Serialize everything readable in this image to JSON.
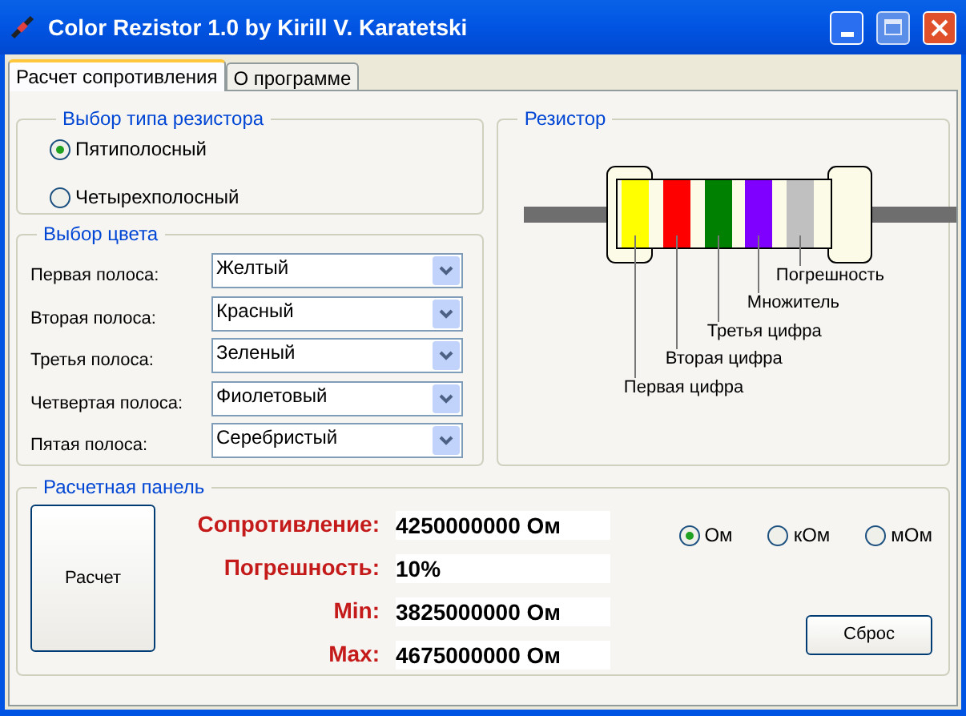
{
  "window": {
    "title": "Color Rezistor 1.0 by Kirill V. Karatetski"
  },
  "tabs": [
    {
      "label": "Расчет сопротивления",
      "selected": true
    },
    {
      "label": "О программе",
      "selected": false
    }
  ],
  "resistor_type": {
    "title": "Выбор типа резистора",
    "options": [
      {
        "label": "Пятиполосный",
        "selected": true
      },
      {
        "label": "Четырехполосный",
        "selected": false
      }
    ]
  },
  "color_choice": {
    "title": "Выбор цвета",
    "bands": [
      {
        "label": "Первая полоса:",
        "value": "Желтый"
      },
      {
        "label": "Вторая полоса:",
        "value": "Красный"
      },
      {
        "label": "Третья полоса:",
        "value": "Зеленый"
      },
      {
        "label": "Четвертая полоса:",
        "value": "Фиолетовый"
      },
      {
        "label": "Пятая полоса:",
        "value": "Серебристый"
      }
    ]
  },
  "resistor": {
    "title": "Резистор",
    "bands": [
      {
        "color": "#ffff00"
      },
      {
        "color": "#ff0000"
      },
      {
        "color": "#008000"
      },
      {
        "color": "#8000ff"
      },
      {
        "color": "#c0c0c0"
      }
    ],
    "captions": [
      "Погрешность",
      "Множитель",
      "Третья цифра",
      "Вторая цифра",
      "Первая цифра"
    ]
  },
  "calc_panel": {
    "title": "Расчетная панель",
    "calculate_button": "Расчет",
    "results": [
      {
        "label": "Сопротивление:",
        "value": "4250000000 Ом"
      },
      {
        "label": "Погрешность:",
        "value": "10%"
      },
      {
        "label": "Min:",
        "value": "3825000000 Ом"
      },
      {
        "label": "Max:",
        "value": "4675000000 Ом"
      }
    ],
    "units": [
      {
        "label": "Ом",
        "selected": true
      },
      {
        "label": "кОм",
        "selected": false
      },
      {
        "label": "мОм",
        "selected": false
      }
    ],
    "reset_button": "Сброс"
  }
}
